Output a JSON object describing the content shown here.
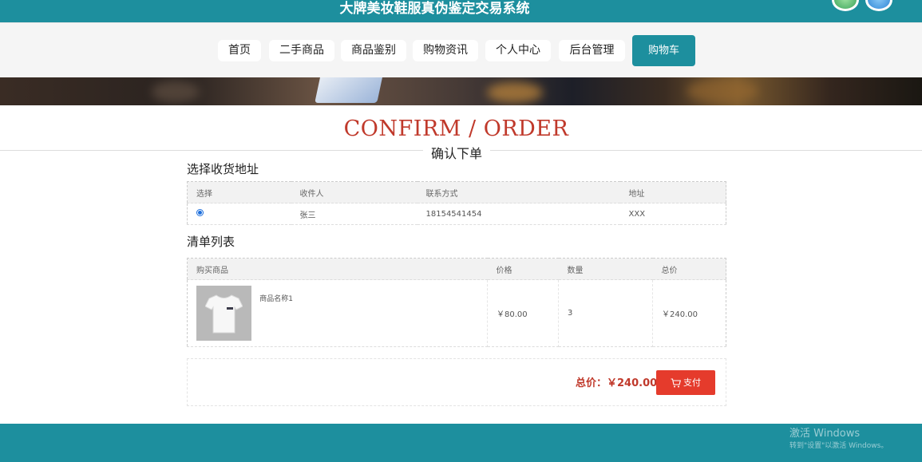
{
  "header": {
    "site_title": "大牌美妆鞋服真伪鉴定交易系统"
  },
  "nav": {
    "items": [
      "首页",
      "二手商品",
      "商品鉴别",
      "购物资讯",
      "个人中心",
      "后台管理"
    ],
    "cart_label": "购物车"
  },
  "heading": {
    "english": "CONFIRM / ORDER",
    "chinese": "确认下单"
  },
  "address": {
    "section_title": "选择收货地址",
    "columns": [
      "选择",
      "收件人",
      "联系方式",
      "地址"
    ],
    "rows": [
      {
        "selected": true,
        "recipient": "张三",
        "phone": "18154541454",
        "address": "XXX"
      }
    ]
  },
  "order_list": {
    "section_title": "清单列表",
    "columns": [
      "购买商品",
      "价格",
      "数量",
      "总价"
    ],
    "items": [
      {
        "name": "商品名称1",
        "price": "￥80.00",
        "quantity": "3",
        "subtotal": "￥240.00"
      }
    ]
  },
  "summary": {
    "total_text": "总价：￥240.00",
    "pay_label": "支付"
  },
  "watermark": {
    "line1": "激活 Windows",
    "line2": "转到\"设置\"以激活 Windows。"
  },
  "colors": {
    "primary": "#1d8f9e",
    "accent_red": "#c0392b",
    "pay_button": "#e53b2c"
  },
  "icons": {
    "pay_icon": "cart-icon"
  }
}
